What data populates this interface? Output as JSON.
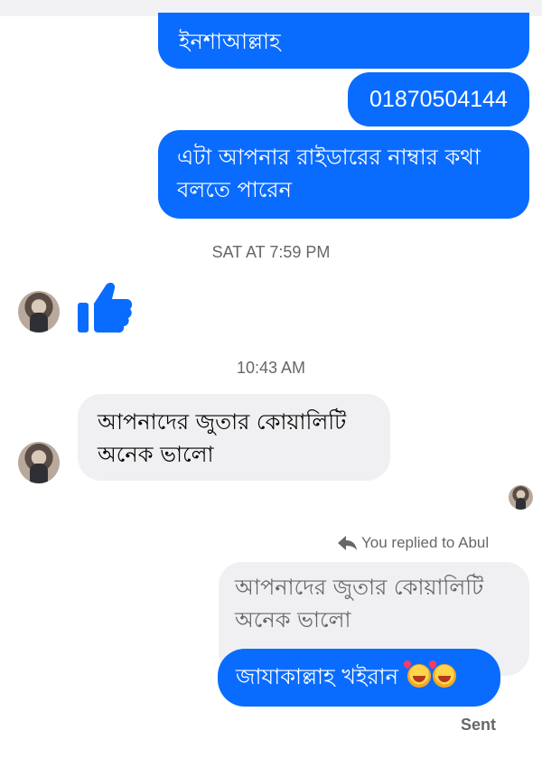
{
  "colors": {
    "outgoing_bubble": "#0a6cff",
    "incoming_bubble": "#f0f0f2",
    "meta_text": "#65676b",
    "like_icon": "#0a6cff"
  },
  "messages": {
    "outgoing_1": "ইনশাআল্লাহ",
    "outgoing_2": "01870504144",
    "outgoing_3": "এটা আপনার রাইডারের নাম্বার কথা বলতে পারেন",
    "incoming_1": "আপনাদের জুতার কোয়ালিটি অনেক ভালো",
    "quoted_reply": "আপনাদের জুতার কোয়ালিটি অনেক ভালো",
    "outgoing_reply": "জাযাকাল্লাহ খইরান",
    "reply_emoji": [
      "smiling-face-with-hearts",
      "smiling-face-with-hearts"
    ]
  },
  "timestamps": {
    "first": "SAT AT 7:59 PM",
    "second": "10:43 AM"
  },
  "reply_context": {
    "label": "You replied to Abul",
    "icon": "reply-arrow-icon"
  },
  "status": {
    "sent": "Sent"
  },
  "icons": {
    "like": "thumbs-up-icon",
    "avatar": "contact-avatar"
  }
}
